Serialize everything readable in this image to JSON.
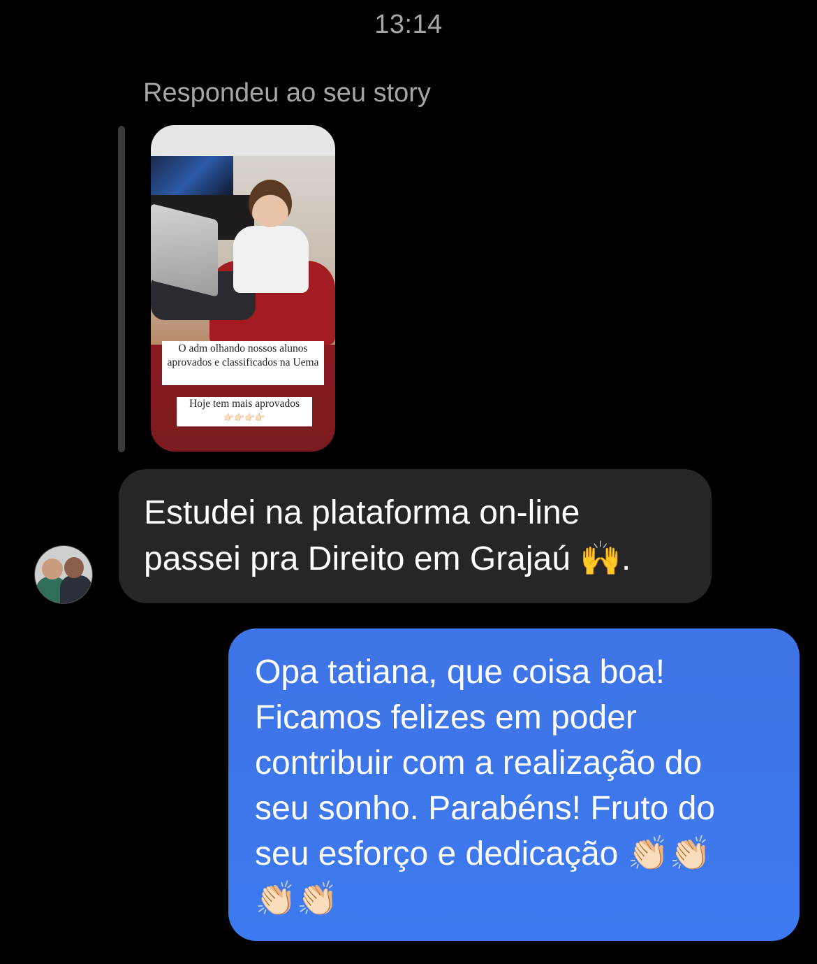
{
  "header": {
    "timestamp": "13:14"
  },
  "reply": {
    "label": "Respondeu ao seu story",
    "story": {
      "caption_main": "O adm olhando nossos alunos aprovados e classificados na Uema",
      "caption_secondary": "Hoje tem mais aprovados",
      "caption_secondary_emoji": "👉🏻👉🏻👉🏻👉🏻"
    }
  },
  "messages": {
    "incoming": {
      "text": "Estudei na plataforma on-line\npassei pra Direito em Grajaú 🙌."
    },
    "outgoing": {
      "text": "Opa tatiana, que coisa boa!\nFicamos felizes em poder\ncontribuir com a realização do\nseu sonho. Parabéns! Fruto do\nseu esforço e dedicação 👏🏻👏🏻\n👏🏻👏🏻"
    }
  },
  "colors": {
    "background": "#000000",
    "incoming_bubble": "#262628",
    "outgoing_bubble": "#3d7aef",
    "muted_text": "#a6a6a6"
  }
}
